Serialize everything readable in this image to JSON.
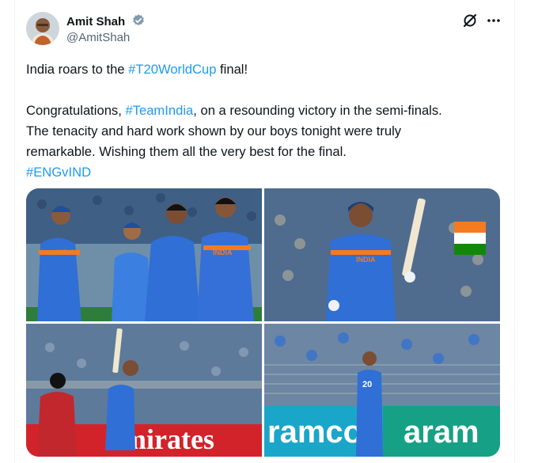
{
  "tweet": {
    "display_name": "Amit Shah",
    "handle": "@AmitShah",
    "verified_badge_icon": "verified-badge-icon",
    "line1_pre": "India roars to the ",
    "line1_tag": "#T20WorldCup",
    "line1_post": " final!",
    "line2_pre": "Congratulations, ",
    "line2_tag": "#TeamIndia",
    "line2_post": ", on a resounding victory in the semi-finals.",
    "line3": "The tenacity and hard work shown by our boys tonight were truly",
    "line4": "remarkable. Wishing them all the very best for the final.",
    "line5_tag": "#ENGvIND"
  },
  "photos": [
    {
      "jersey_text": "INDIA"
    },
    {
      "jersey_text": "INDIA"
    },
    {
      "banner_text": "mirates"
    },
    {
      "banner_left": "ramco",
      "banner_right": "aram",
      "jersey_number": "20"
    }
  ],
  "colors": {
    "accent": "#1d9bf0",
    "jersey": "#2f6fd6",
    "orange": "#f47b20"
  }
}
